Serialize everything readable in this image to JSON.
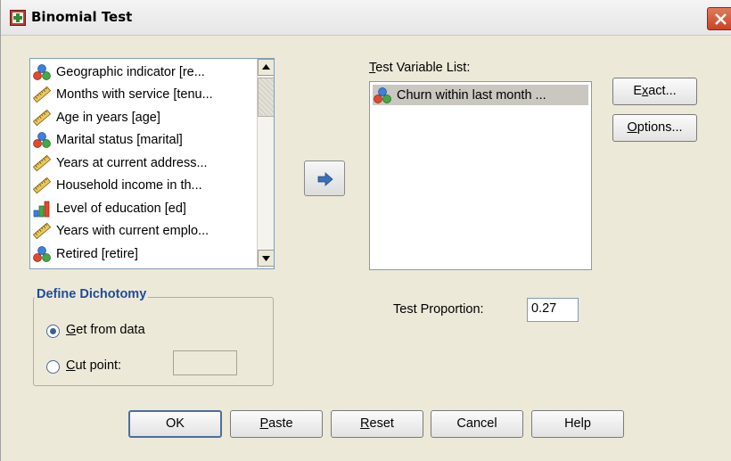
{
  "window": {
    "title": "Binomial Test"
  },
  "source_list": {
    "items": [
      {
        "label": "Geographic indicator [re...",
        "icon": "nominal-icon"
      },
      {
        "label": "Months with service [tenu...",
        "icon": "scale-icon"
      },
      {
        "label": "Age in years [age]",
        "icon": "scale-icon"
      },
      {
        "label": "Marital status [marital]",
        "icon": "nominal-icon"
      },
      {
        "label": "Years at current address...",
        "icon": "scale-icon"
      },
      {
        "label": "Household income in th...",
        "icon": "scale-icon"
      },
      {
        "label": "Level of education [ed]",
        "icon": "ordinal-icon"
      },
      {
        "label": "Years with current emplo...",
        "icon": "scale-icon"
      },
      {
        "label": "Retired [retire]",
        "icon": "nominal-icon"
      }
    ]
  },
  "test_variable_list": {
    "label": "Test Variable List:",
    "items": [
      {
        "label": "Churn within last month ...",
        "icon": "nominal-icon"
      }
    ]
  },
  "side_buttons": {
    "exact": "Exact...",
    "options": "Options..."
  },
  "define_dichotomy": {
    "title": "Define Dichotomy",
    "get_from_data": "Get from data",
    "cut_point": "Cut point:",
    "selected": "get_from_data",
    "cut_point_value": ""
  },
  "test_proportion": {
    "label": "Test Proportion:",
    "value": "0.27"
  },
  "buttons": {
    "ok": "OK",
    "paste": "Paste",
    "reset": "Reset",
    "cancel": "Cancel",
    "help": "Help"
  },
  "colors": {
    "dialog_bg": "#ece9d8",
    "list_border": "#7f9db9",
    "group_title": "#1f4b9c",
    "selection": "#c9c7c0"
  }
}
